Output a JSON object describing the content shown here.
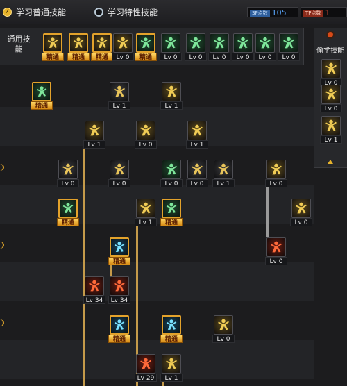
{
  "tabs": {
    "normal": "学习普通技能",
    "trait": "学习特性技能"
  },
  "points": {
    "sp_tag": "SP点数",
    "sp_value": "105",
    "tp_tag": "TP点数",
    "tp_value": "1"
  },
  "general": {
    "label": "通用技能"
  },
  "side_panel": {
    "title": "偷学技能"
  },
  "mastery_label": "精通",
  "colors": {
    "accent_gold": "#e3a22b",
    "sp_value": "#5aa8ff",
    "tp_value": "#ff5a3c",
    "tree_line": "#c49a4a",
    "prereq_line": "#9a9a9a"
  },
  "general_skills": [
    {
      "icon": "sitting-figure",
      "level": "精通"
    },
    {
      "icon": "crouch-figure",
      "level": "精通"
    },
    {
      "icon": "running-figure",
      "level": "精通"
    },
    {
      "icon": "wings-crest",
      "level": "Lv 0"
    },
    {
      "icon": "target-sigil",
      "level": "精通"
    },
    {
      "icon": "crosshair",
      "level": "Lv 0"
    },
    {
      "icon": "green-figure",
      "level": "Lv 0"
    },
    {
      "icon": "dash-figure",
      "level": "Lv 0"
    },
    {
      "icon": "eye-target",
      "level": "Lv 0"
    },
    {
      "icon": "flex-figure",
      "level": "Lv 0"
    },
    {
      "icon": "tribal-figure",
      "level": "Lv 0"
    }
  ],
  "stolen_skills": [
    {
      "icon": "hooded-figure",
      "level": "Lv 0"
    },
    {
      "icon": "flame-hand",
      "level": "Lv 0"
    },
    {
      "icon": "strike-figure",
      "level": "Lv 1"
    }
  ],
  "tree_skills": [
    {
      "icon": "green-claw",
      "level": "精通"
    },
    {
      "icon": "dark-figure",
      "level": "Lv 1"
    },
    {
      "icon": "leap-figure",
      "level": "Lv 1"
    },
    {
      "icon": "kick-figure",
      "level": "Lv 1"
    },
    {
      "icon": "sitting-figure",
      "level": "Lv 0"
    },
    {
      "icon": "fire-figure",
      "level": "Lv 1"
    },
    {
      "icon": "shatter",
      "level": "Lv 0"
    },
    {
      "icon": "swirl",
      "level": "Lv 0"
    },
    {
      "icon": "green-brute",
      "level": "Lv 0"
    },
    {
      "icon": "wolf-figure",
      "level": "Lv 0"
    },
    {
      "icon": "spin-figure",
      "level": "Lv 1"
    },
    {
      "icon": "stance-figure",
      "level": "Lv 0"
    },
    {
      "icon": "green-orb",
      "level": "精通"
    },
    {
      "icon": "grab-figure",
      "level": "Lv 1"
    },
    {
      "icon": "lightning-figure",
      "level": "精通"
    },
    {
      "icon": "fire-burst",
      "level": "Lv 0"
    },
    {
      "icon": "aura-figure",
      "level": "精通"
    },
    {
      "icon": "red-figure",
      "level": "Lv 0"
    },
    {
      "icon": "red-swirl",
      "level": "Lv 34"
    },
    {
      "icon": "red-claw",
      "level": "Lv 34"
    },
    {
      "icon": "ice-burst",
      "level": "精通"
    },
    {
      "icon": "ice-figure",
      "level": "精通"
    },
    {
      "icon": "slide-figure",
      "level": "Lv 0"
    },
    {
      "icon": "red-strike",
      "level": "Lv 29"
    },
    {
      "icon": "sit-figure",
      "level": "Lv 1"
    }
  ]
}
